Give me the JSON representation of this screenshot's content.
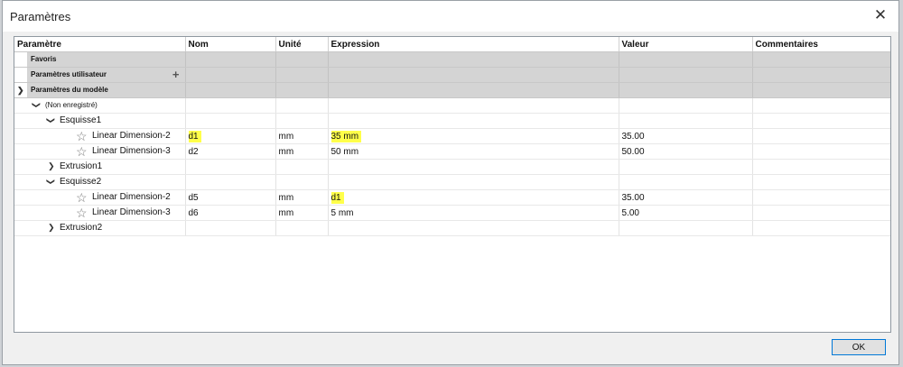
{
  "window": {
    "title": "Paramètres"
  },
  "columns": {
    "param": "Paramètre",
    "nom": "Nom",
    "unite": "Unité",
    "expression": "Expression",
    "valeur": "Valeur",
    "commentaires": "Commentaires"
  },
  "groups": {
    "favoris": "Favoris",
    "utilisateur": "Paramètres utilisateur",
    "modele": "Paramètres du modèle"
  },
  "tree": {
    "non_enregistre": "(Non enregistré)",
    "esquisse1": "Esquisse1",
    "extrusion1": "Extrusion1",
    "esquisse2": "Esquisse2",
    "extrusion2": "Extrusion2"
  },
  "rows": [
    {
      "label": "Linear Dimension-2",
      "nom": "d1",
      "unite": "mm",
      "expression": "35 mm",
      "valeur": "35.00"
    },
    {
      "label": "Linear Dimension-3",
      "nom": "d2",
      "unite": "mm",
      "expression": "50 mm",
      "valeur": "50.00"
    },
    {
      "label": "Linear Dimension-2",
      "nom": "d5",
      "unite": "mm",
      "expression": "d1",
      "valeur": "35.00"
    },
    {
      "label": "Linear Dimension-3",
      "nom": "d6",
      "unite": "mm",
      "expression": "5 mm",
      "valeur": "5.00"
    }
  ],
  "icons": {
    "close": "close-icon",
    "star": "star-outline-icon",
    "chevron_down": "chevron-down-icon",
    "chevron_right": "chevron-right-icon",
    "plus": "plus-icon"
  },
  "colors": {
    "highlight": "#ffff4a",
    "group_bg": "#d4d4d4",
    "ok_border": "#0078d7"
  },
  "buttons": {
    "ok": "OK"
  }
}
